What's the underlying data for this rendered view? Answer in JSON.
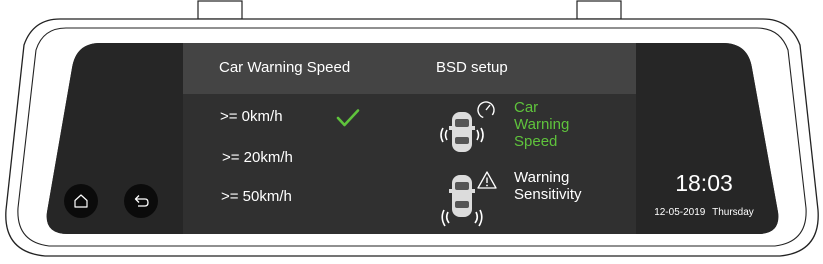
{
  "menu": {
    "left_header": "Car Warning Speed",
    "right_header": "BSD setup",
    "speed_options": [
      {
        "label": ">= 0km/h",
        "selected": true
      },
      {
        "label": ">= 20km/h",
        "selected": false
      },
      {
        "label": ">= 50km/h",
        "selected": false
      }
    ],
    "bsd_items": [
      {
        "label_lines": [
          "Car",
          "Warning",
          "Speed"
        ],
        "active": true,
        "icon": "speedometer-icon"
      },
      {
        "label_lines": [
          "Warning",
          "Sensitivity"
        ],
        "active": false,
        "icon": "warning-triangle-icon"
      }
    ]
  },
  "clock": {
    "time": "18:03",
    "date": "12-05-2019",
    "weekday": "Thursday"
  },
  "nav": {
    "home_icon": "home-icon",
    "back_icon": "back-arrow-icon"
  },
  "colors": {
    "accent_green": "#5fc33c",
    "screen_dark": "#303030",
    "header_bar": "#444444",
    "side_panel": "#262626"
  }
}
